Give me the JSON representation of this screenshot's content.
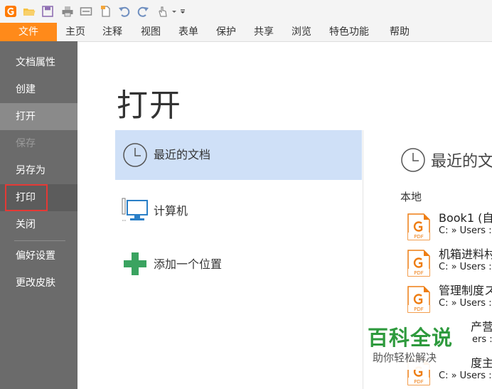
{
  "menubar": {
    "file": "文件",
    "items": [
      "主页",
      "注释",
      "视图",
      "表单",
      "保护",
      "共享",
      "浏览",
      "特色功能",
      "帮助"
    ]
  },
  "sidebar": {
    "items": [
      {
        "label": "文档属性"
      },
      {
        "label": "创建"
      },
      {
        "label": "打开"
      },
      {
        "label": "保存"
      },
      {
        "label": "另存为"
      },
      {
        "label": "打印"
      },
      {
        "label": "关闭"
      },
      {
        "label": "偏好设置"
      },
      {
        "label": "更改皮肤"
      }
    ]
  },
  "main": {
    "title": "打开",
    "locations": [
      {
        "label": "最近的文档",
        "icon": "clock-icon"
      },
      {
        "label": "计算机",
        "icon": "computer-icon"
      },
      {
        "label": "添加一个位置",
        "icon": "plus-icon"
      }
    ]
  },
  "recent": {
    "heading": "最近的文",
    "local_label": "本地",
    "files": [
      {
        "name": "Book1 (自",
        "path": "C: » Users :"
      },
      {
        "name": "机箱进料村",
        "path": "C: » Users :"
      },
      {
        "name": "管理制度ス",
        "path": "C: » Users :"
      },
      {
        "name": "产营",
        "path": "ers :"
      },
      {
        "name": "度主",
        "path": "C: » Users :"
      }
    ]
  },
  "watermark": {
    "title": "百科全说",
    "subtitle": "助你轻松解决"
  },
  "colors": {
    "accent": "#ff8a1a",
    "sidebar": "#6b6b6b",
    "selected": "#cfe0f7",
    "highlight_box": "#e53935",
    "watermark": "#2e9a3d"
  }
}
